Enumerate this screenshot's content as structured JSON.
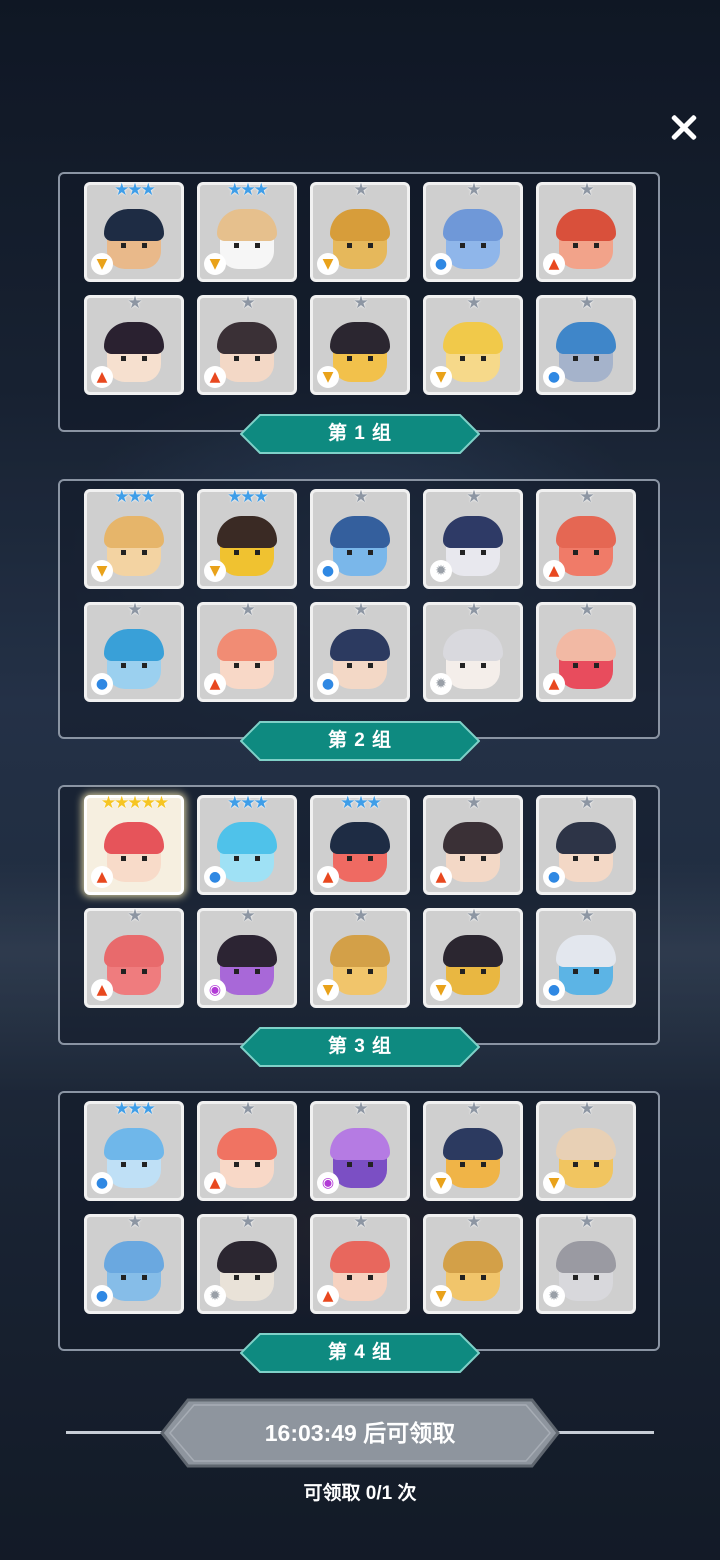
{
  "groups": [
    {
      "label": "第 1 组",
      "cards": [
        {
          "stars": 3,
          "star_color": "blue",
          "element": "wind-icon",
          "skin": "#e9b98a",
          "hair": "#1e2c44"
        },
        {
          "stars": 3,
          "star_color": "blue",
          "element": "wind-icon",
          "skin": "#f6f6f6",
          "hair": "#e6c08d"
        },
        {
          "stars": 1,
          "star_color": "gray",
          "element": "wind-icon",
          "skin": "#e6b85b",
          "hair": "#d79d3a"
        },
        {
          "stars": 1,
          "star_color": "gray",
          "element": "water-icon",
          "skin": "#8fb6ea",
          "hair": "#6f98d8"
        },
        {
          "stars": 1,
          "star_color": "gray",
          "element": "fire-icon",
          "skin": "#f2a38a",
          "hair": "#d9503b"
        },
        {
          "stars": 1,
          "star_color": "gray",
          "element": "fire-icon",
          "skin": "#f6e0cf",
          "hair": "#2a2130"
        },
        {
          "stars": 1,
          "star_color": "gray",
          "element": "fire-icon",
          "skin": "#f3d8c6",
          "hair": "#3a3036"
        },
        {
          "stars": 1,
          "star_color": "gray",
          "element": "wind-icon",
          "skin": "#f2c14b",
          "hair": "#2b2630"
        },
        {
          "stars": 1,
          "star_color": "gray",
          "element": "wind-icon",
          "skin": "#f6d98a",
          "hair": "#f1c94a"
        },
        {
          "stars": 1,
          "star_color": "gray",
          "element": "water-icon",
          "skin": "#a5b3cb",
          "hair": "#3f86c9"
        }
      ]
    },
    {
      "label": "第 2 组",
      "cards": [
        {
          "stars": 3,
          "star_color": "blue",
          "element": "wind-icon",
          "skin": "#f3d3a2",
          "hair": "#e6b56a"
        },
        {
          "stars": 3,
          "star_color": "blue",
          "element": "wind-icon",
          "skin": "#f0c230",
          "hair": "#3a2a24"
        },
        {
          "stars": 1,
          "star_color": "gray",
          "element": "water-icon",
          "skin": "#7ab7ea",
          "hair": "#345f9d"
        },
        {
          "stars": 1,
          "star_color": "gray",
          "element": "light-icon",
          "skin": "#e8e8ee",
          "hair": "#2e3a66"
        },
        {
          "stars": 1,
          "star_color": "gray",
          "element": "fire-icon",
          "skin": "#f07b68",
          "hair": "#e56753"
        },
        {
          "stars": 1,
          "star_color": "gray",
          "element": "water-icon",
          "skin": "#9bd0ef",
          "hair": "#39a0d8"
        },
        {
          "stars": 1,
          "star_color": "gray",
          "element": "fire-icon",
          "skin": "#f8d8c7",
          "hair": "#f18c74"
        },
        {
          "stars": 1,
          "star_color": "gray",
          "element": "water-icon",
          "skin": "#f3d8c6",
          "hair": "#2c3a60"
        },
        {
          "stars": 1,
          "star_color": "gray",
          "element": "light-icon",
          "skin": "#f4eeea",
          "hair": "#d9d9de"
        },
        {
          "stars": 1,
          "star_color": "gray",
          "element": "fire-icon",
          "skin": "#e84c5d",
          "hair": "#f2b9a4"
        }
      ]
    },
    {
      "label": "第 3 组",
      "cards": [
        {
          "stars": 5,
          "star_color": "gold",
          "element": "fire-icon",
          "skin": "#f8dbc9",
          "hair": "#e6545a"
        },
        {
          "stars": 3,
          "star_color": "blue",
          "element": "water-icon",
          "skin": "#9fe1f5",
          "hair": "#4fc2ea"
        },
        {
          "stars": 3,
          "star_color": "blue",
          "element": "fire-icon",
          "skin": "#ef6a62",
          "hair": "#1e2c44"
        },
        {
          "stars": 1,
          "star_color": "gray",
          "element": "fire-icon",
          "skin": "#f3d8c6",
          "hair": "#3a3036"
        },
        {
          "stars": 1,
          "star_color": "gray",
          "element": "water-icon",
          "skin": "#f3d8c6",
          "hair": "#2d3447"
        },
        {
          "stars": 1,
          "star_color": "gray",
          "element": "fire-icon",
          "skin": "#ef7c7e",
          "hair": "#e86a6c"
        },
        {
          "stars": 1,
          "star_color": "gray",
          "element": "dark-icon",
          "skin": "#a868d8",
          "hair": "#2c2433"
        },
        {
          "stars": 1,
          "star_color": "gray",
          "element": "wind-icon",
          "skin": "#f1c56b",
          "hair": "#d3a048"
        },
        {
          "stars": 1,
          "star_color": "gray",
          "element": "wind-icon",
          "skin": "#e9b741",
          "hair": "#2b2630"
        },
        {
          "stars": 1,
          "star_color": "gray",
          "element": "water-icon",
          "skin": "#5cb4e5",
          "hair": "#e3e7ee"
        }
      ]
    },
    {
      "label": "第 4 组",
      "cards": [
        {
          "stars": 3,
          "star_color": "blue",
          "element": "water-icon",
          "skin": "#bfe0f6",
          "hair": "#6fb7ea"
        },
        {
          "stars": 1,
          "star_color": "gray",
          "element": "fire-icon",
          "skin": "#f8d8c7",
          "hair": "#f07362"
        },
        {
          "stars": 1,
          "star_color": "gray",
          "element": "dark-icon",
          "skin": "#7b4fc4",
          "hair": "#b57be3"
        },
        {
          "stars": 1,
          "star_color": "gray",
          "element": "wind-icon",
          "skin": "#f0b447",
          "hair": "#2c3a60"
        },
        {
          "stars": 1,
          "star_color": "gray",
          "element": "wind-icon",
          "skin": "#f1c560",
          "hair": "#e8d0b5"
        },
        {
          "stars": 1,
          "star_color": "gray",
          "element": "water-icon",
          "skin": "#86bde8",
          "hair": "#6aa8e0"
        },
        {
          "stars": 1,
          "star_color": "gray",
          "element": "light-icon",
          "skin": "#e9e2d8",
          "hair": "#2b2630"
        },
        {
          "stars": 1,
          "star_color": "gray",
          "element": "fire-icon",
          "skin": "#f6d2c0",
          "hair": "#e8675d"
        },
        {
          "stars": 1,
          "star_color": "gray",
          "element": "wind-icon",
          "skin": "#f1c56b",
          "hair": "#d3a048"
        },
        {
          "stars": 1,
          "star_color": "gray",
          "element": "light-icon",
          "skin": "#d8d8dc",
          "hair": "#9a9aa2"
        }
      ]
    }
  ],
  "timer": {
    "text": "16:03:49 后可领取"
  },
  "claim": {
    "text": "可领取 0/1 次"
  },
  "colors": {
    "banner": "#0e8a80",
    "banner_border": "#7fd1c8",
    "timer_bg": "#8e959e"
  }
}
